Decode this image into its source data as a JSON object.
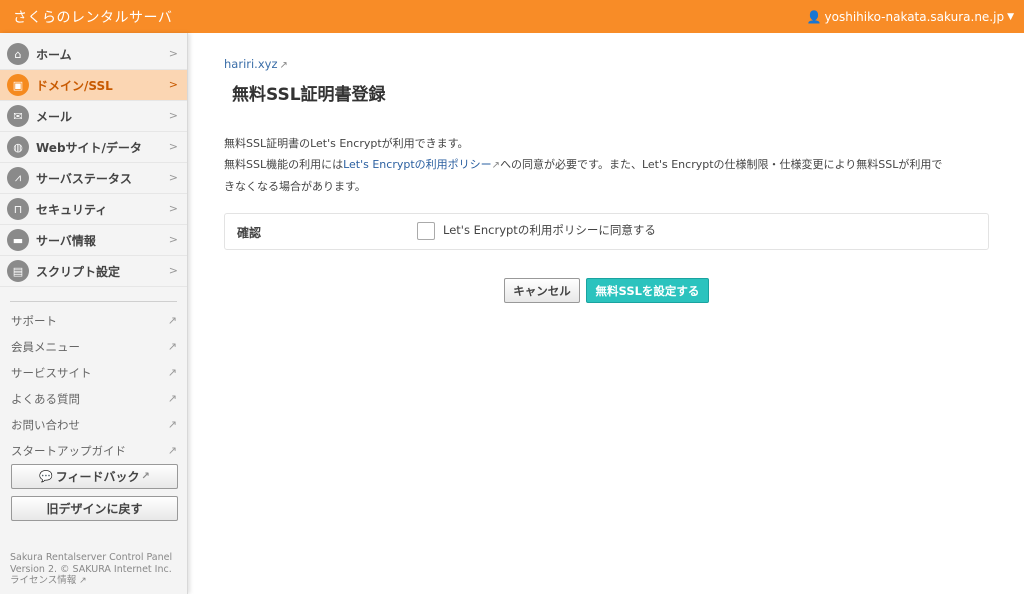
{
  "header": {
    "brand": "さくらのレンタルサーバ",
    "user": "yoshihiko-nakata.sakura.ne.jp"
  },
  "sidebar": {
    "items": [
      {
        "label": "ホーム",
        "icon": "home-icon",
        "glyph": "⌂"
      },
      {
        "label": "ドメイン/SSL",
        "icon": "lock-icon",
        "glyph": "▣"
      },
      {
        "label": "メール",
        "icon": "mail-icon",
        "glyph": "✉"
      },
      {
        "label": "Webサイト/データ",
        "icon": "globe-icon",
        "glyph": "◍"
      },
      {
        "label": "サーバステータス",
        "icon": "chart-icon",
        "glyph": "⩘"
      },
      {
        "label": "セキュリティ",
        "icon": "padlock-icon",
        "glyph": "⊓"
      },
      {
        "label": "サーバ情報",
        "icon": "server-icon",
        "glyph": "▬"
      },
      {
        "label": "スクリプト設定",
        "icon": "script-icon",
        "glyph": "▤"
      }
    ],
    "links": [
      "サポート",
      "会員メニュー",
      "サービスサイト",
      "よくある質問",
      "お問い合わせ",
      "スタートアップガイド"
    ],
    "feedback_label": "フィードバック",
    "old_design_label": "旧デザインに戻す",
    "footer": {
      "line1": "Sakura Rentalserver Control Panel",
      "line2": "Version 2. © SAKURA Internet Inc.",
      "license": "ライセンス情報"
    }
  },
  "main": {
    "domain": "hariri.xyz",
    "title": "無料SSL証明書登録",
    "desc1": "無料SSL証明書のLet's Encryptが利用できます。",
    "desc2_pre": "無料SSL機能の利用には",
    "desc2_link": "Let's Encryptの利用ポリシー",
    "desc2_post": "への同意が必要です。また、Let's Encryptの仕様制限・仕様変更により無料SSLが利用で",
    "desc3": "きなくなる場合があります。",
    "confirm_label": "確認",
    "agree_text": "Let's Encryptの利用ポリシーに同意する",
    "cancel_label": "キャンセル",
    "set_label": "無料SSLを設定する"
  }
}
